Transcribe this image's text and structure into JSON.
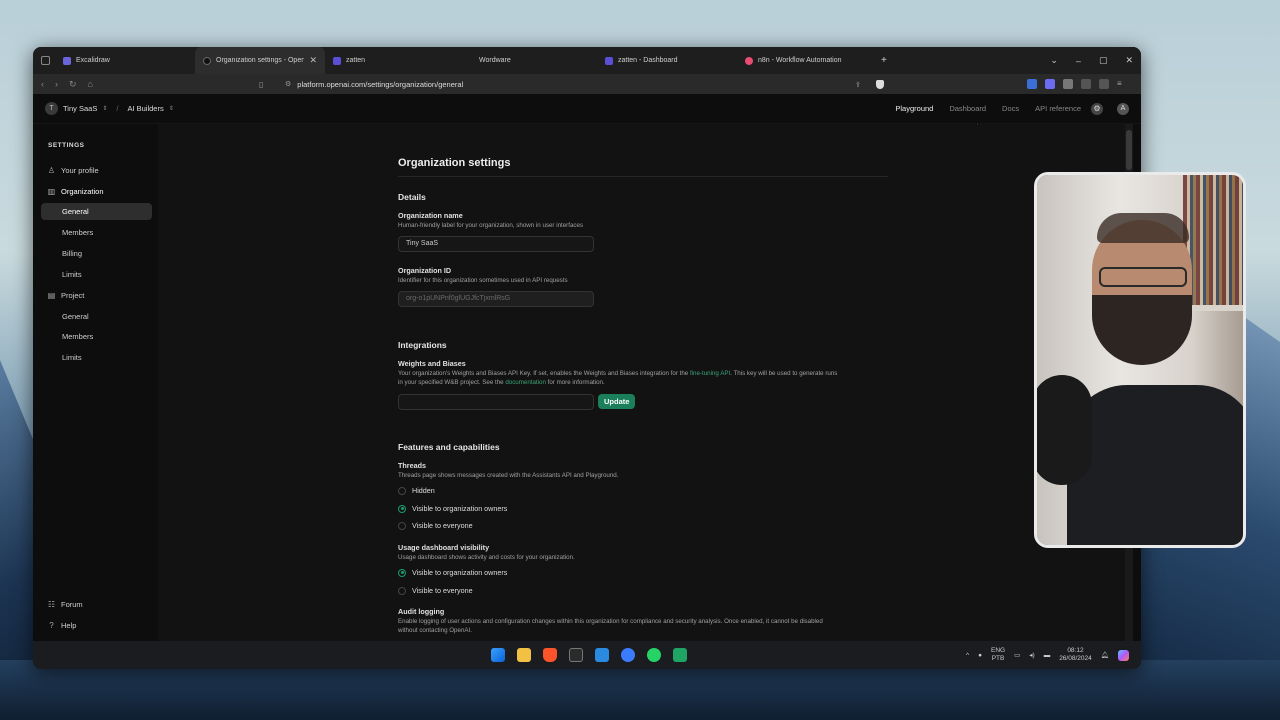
{
  "browser": {
    "tabs": [
      {
        "title": "Excalidraw",
        "color": "#6965db"
      },
      {
        "title": "Organization settings - OpenAI",
        "color": "#222222",
        "active": true
      },
      {
        "title": "zatten",
        "color": "#5b4fd6"
      },
      {
        "title": "Wordware",
        "color": "#333333"
      },
      {
        "title": "zatten - Dashboard",
        "color": "#5b4fd6"
      },
      {
        "title": "n8n - Workflow Automation",
        "color": "#ea4b71"
      }
    ],
    "url": "platform.openai.com/settings/organization/general",
    "add_tab": "+",
    "controls": {
      "dropdown": "⌄",
      "minimize": "–",
      "maximize": "▢",
      "close": "✕"
    }
  },
  "header": {
    "org_initial": "T",
    "org_name": "Tiny SaaS",
    "separator": "/",
    "project_name": "AI Builders",
    "nav": [
      "Playground",
      "Dashboard",
      "Docs",
      "API reference"
    ],
    "user_initial": "A"
  },
  "sidebar": {
    "heading": "SETTINGS",
    "items": [
      {
        "label": "Your profile",
        "icon": "user-icon"
      },
      {
        "label": "Organization",
        "icon": "building-icon"
      },
      {
        "label": "General",
        "selected": true
      },
      {
        "label": "Members"
      },
      {
        "label": "Billing"
      },
      {
        "label": "Limits"
      },
      {
        "label": "Project",
        "icon": "project-icon"
      },
      {
        "label": "General"
      },
      {
        "label": "Members"
      },
      {
        "label": "Limits"
      }
    ],
    "footer": [
      {
        "label": "Forum",
        "icon": "forum-icon"
      },
      {
        "label": "Help",
        "icon": "help-icon"
      }
    ]
  },
  "page": {
    "title": "Organization settings",
    "details": {
      "heading": "Details",
      "org_name_label": "Organization name",
      "org_name_desc": "Human-friendly label for your organization, shown in user interfaces",
      "org_name_value": "Tiny SaaS",
      "org_id_label": "Organization ID",
      "org_id_desc": "Identifier for this organization sometimes used in API requests",
      "org_id_value": "org-o1pUNPnf0glUGJfcTjxmlRsG"
    },
    "integrations": {
      "heading": "Integrations",
      "wb_label": "Weights and Biases",
      "wb_desc_1": "Your organization's Weights and Biases API Key. If set, enables the Weights and Biases integration for the ",
      "wb_link_1": "fine-tuning API",
      "wb_desc_2": ". This key will be used to generate runs",
      "wb_desc_3": "in your specified W&B project. See the ",
      "wb_link_2": "documentation",
      "wb_desc_4": " for more information.",
      "key_value": "",
      "update_button": "Update"
    },
    "features": {
      "heading": "Features and capabilities",
      "threads_label": "Threads",
      "threads_desc": "Threads page shows messages created with the Assistants API and Playground.",
      "threads_options": [
        {
          "label": "Hidden",
          "selected": false
        },
        {
          "label": "Visible to organization owners",
          "selected": true
        },
        {
          "label": "Visible to everyone",
          "selected": false
        }
      ],
      "usage_label": "Usage dashboard visibility",
      "usage_desc": "Usage dashboard shows activity and costs for your organization.",
      "usage_options": [
        {
          "label": "Visible to organization owners",
          "selected": true
        },
        {
          "label": "Visible to everyone",
          "selected": false
        }
      ],
      "audit_label": "Audit logging",
      "audit_desc_1": "Enable logging of user actions and configuration changes within this organization for compliance and security analysis. Once enabled, it cannot be disabled",
      "audit_desc_2": "without contacting OpenAI."
    }
  },
  "taskbar": {
    "lang": "ENG",
    "lang_sub": "PTB",
    "time": "08:12",
    "date": "26/08/2024",
    "icons": [
      "windows-icon",
      "explorer-icon",
      "brave-icon",
      "terminal-icon",
      "vscode-icon",
      "app-icon",
      "whatsapp-icon",
      "sheets-icon"
    ]
  }
}
